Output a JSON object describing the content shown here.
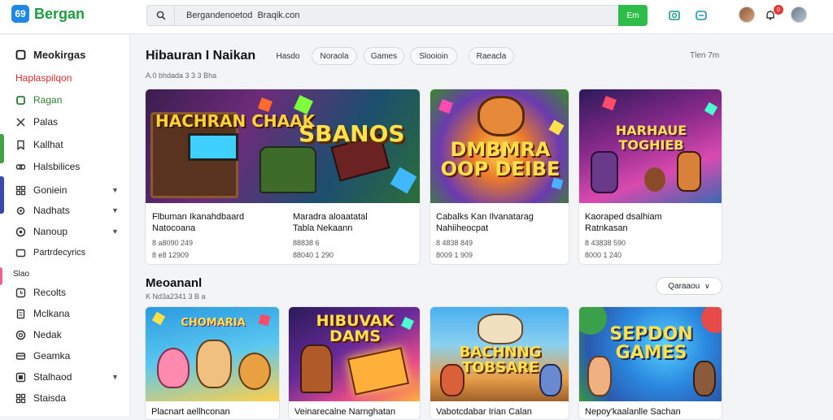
{
  "app": {
    "name": "Bergan",
    "logo_mark": "69"
  },
  "search": {
    "value": "Bergandenoetod  Braqik.con",
    "button_label": "Em"
  },
  "topbar": {
    "notification_count": "0"
  },
  "sidebar": {
    "items": [
      {
        "label": "Meokirgas",
        "icon": "square-outline-icon"
      },
      {
        "label": "Haplaspilqon",
        "icon": ""
      },
      {
        "label": "Ragan",
        "icon": "leaf-icon"
      },
      {
        "label": "Palas",
        "icon": "tools-icon"
      },
      {
        "label": "Kallhat",
        "icon": "bookmark-icon"
      },
      {
        "label": "Halsbilices",
        "icon": "link-icon"
      },
      {
        "label": "Goniein",
        "icon": "grid-icon"
      },
      {
        "label": "Nadhats",
        "icon": "gear-icon"
      },
      {
        "label": "Nanoup",
        "icon": "circle-icon"
      },
      {
        "label": "Partrdecyrics",
        "icon": "folder-icon"
      },
      {
        "label": "Slao",
        "icon": ""
      },
      {
        "label": "Recolts",
        "icon": "clock-icon"
      },
      {
        "label": "Mclkana",
        "icon": "doc-icon"
      },
      {
        "label": "Nedak",
        "icon": "target-icon"
      },
      {
        "label": "Geamka",
        "icon": "card-icon"
      },
      {
        "label": "Stalhaod",
        "icon": "square-icon"
      },
      {
        "label": "Staisda",
        "icon": "grid-icon"
      }
    ]
  },
  "section1": {
    "title": "Hibauran I Naikan",
    "subtitle": "A.0 bhdada 3 3 3 Bha",
    "filters": [
      "Hasdo",
      "Noraola",
      "Games",
      "Slooioin",
      "Raeacla"
    ],
    "right_text": "Tlen 7m"
  },
  "section2": {
    "title": "Meoananl",
    "subtitle": "K Nd3a2341 3 B a",
    "sort_label": "Qaraaou"
  },
  "cards_row1": [
    {
      "title": "Flbuman Ikanahdbaard\nNatocoana",
      "meta1": "8 a8090 249",
      "meta2": "8 e8 12909",
      "art": "HACHRAN\nCHAAK"
    },
    {
      "title": "Maradra aloaatatal\nTabla Nekaann",
      "meta1": "88838 6",
      "meta2": "88040 1 290",
      "art": "SBANOS"
    },
    {
      "title": "Cabalks Kan Ilvanatarag\nNahiiheocpat",
      "meta1": "8 4838 849",
      "meta2": "8009 1 909",
      "art": "DMBMRA\nOOP DEIBE"
    },
    {
      "title": "Kaoraped dsalhiam\nRatnkasan",
      "meta1": "8 43838 590",
      "meta2": "8000 1 240",
      "art": "HARHAUE\nTOGHIEB"
    }
  ],
  "cards_row2": [
    {
      "title": "Placnart aellhconan",
      "art": "CHOMARIA"
    },
    {
      "title": "Veinarecalne Narnghatan",
      "art": "HIBUVAK\nDAMS"
    },
    {
      "title": "Vabotcdabar Irian Calan",
      "art": "BACHNNG\nTOBSARE"
    },
    {
      "title": "Nepoy'kaalanlle Sachan",
      "art": "SEPDON\nGAMES"
    }
  ],
  "colors": {
    "brand_green": "#2ebd4a",
    "brand_blue": "#1e88e5",
    "accent_red": "#e53935"
  }
}
